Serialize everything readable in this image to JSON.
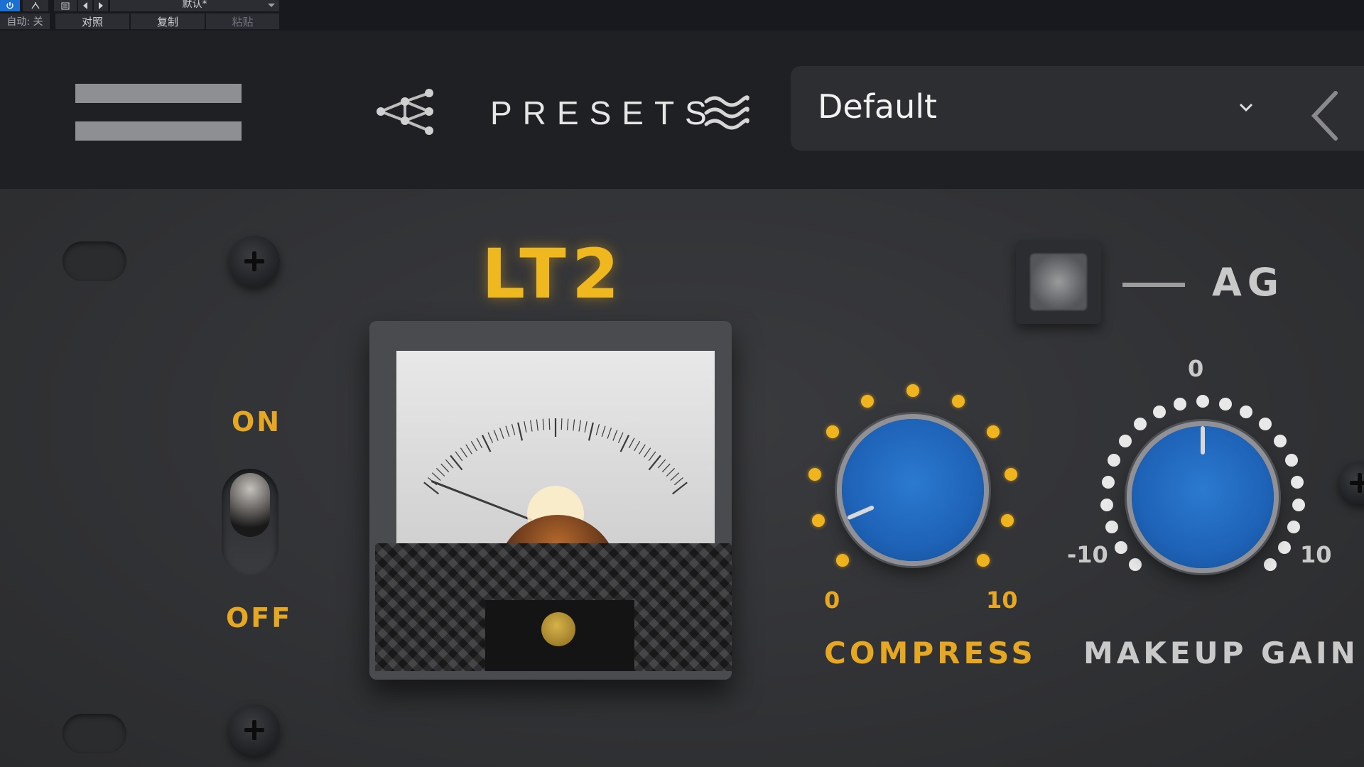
{
  "host_toolbar": {
    "power_icon": "power-icon",
    "routing_icon": "routing-icon",
    "preset_list_icon": "list-icon",
    "prev_icon": "prev-icon",
    "next_icon": "next-icon",
    "preset_value": "默认*",
    "dropdown_icon": "dropdown-icon",
    "auto_label": "自动: 关",
    "compare_label": "对照",
    "copy_label": "复制",
    "paste_label": "粘贴"
  },
  "header": {
    "menu_icon": "hamburger-menu-icon",
    "share_icon": "share-network-icon",
    "presets_label": "PRESETS",
    "waves_icon": "waves-icon",
    "preset_name": "Default",
    "dropdown_icon": "chevron-down-icon",
    "back_icon": "chevron-left-icon"
  },
  "panel": {
    "title": "LT2",
    "on_label": "ON",
    "off_label": "OFF",
    "ag_label": "AG",
    "compress": {
      "label": "COMPRESS",
      "min_label": "0",
      "max_label": "10",
      "value_fraction": 0.08
    },
    "makeup_gain": {
      "label": "MAKEUP GAIN",
      "min_label": "-10",
      "max_label": "10",
      "center_label": "0",
      "value_fraction": 0.5
    },
    "meter": {
      "needle_fraction": 0.02
    }
  },
  "colors": {
    "accent_yellow": "#e6a823",
    "knob_blue": "#1e63b8",
    "panel_grey": "#333437",
    "header_bg": "#1f2023"
  }
}
